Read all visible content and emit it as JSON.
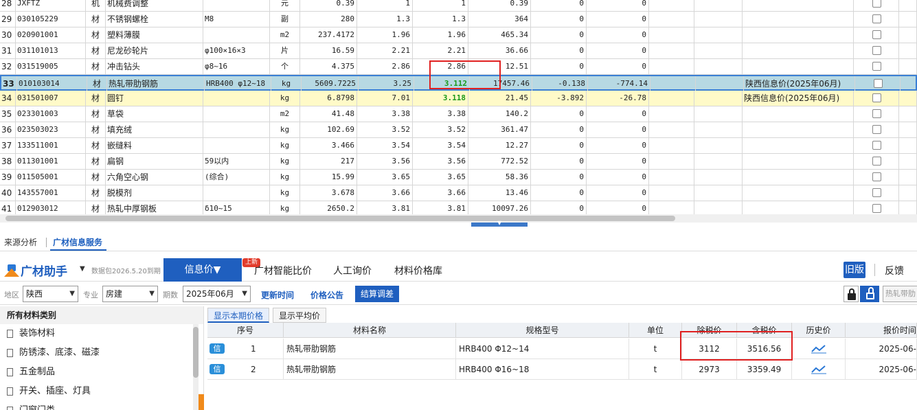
{
  "grid_rows": [
    {
      "no": "28",
      "code": "JXFTZ",
      "cls": "机",
      "name": "机械费调整",
      "spec": "",
      "unit": "元",
      "qty": "0.39",
      "p1": "1",
      "p2": "1",
      "amt": "0.39",
      "d1": "0",
      "d2": "0",
      "note": ""
    },
    {
      "no": "29",
      "code": "030105229",
      "cls": "材",
      "name": "不锈钢螺栓",
      "spec": "M8",
      "unit": "副",
      "qty": "280",
      "p1": "1.3",
      "p2": "1.3",
      "amt": "364",
      "d1": "0",
      "d2": "0",
      "note": ""
    },
    {
      "no": "30",
      "code": "020901001",
      "cls": "材",
      "name": "塑料薄膜",
      "spec": "",
      "unit": "m2",
      "qty": "237.4172",
      "p1": "1.96",
      "p2": "1.96",
      "amt": "465.34",
      "d1": "0",
      "d2": "0",
      "note": ""
    },
    {
      "no": "31",
      "code": "031101013",
      "cls": "材",
      "name": "尼龙砂轮片",
      "spec": "φ100×16×3",
      "unit": "片",
      "qty": "16.59",
      "p1": "2.21",
      "p2": "2.21",
      "amt": "36.66",
      "d1": "0",
      "d2": "0",
      "note": ""
    },
    {
      "no": "32",
      "code": "031519005",
      "cls": "材",
      "name": "冲击钻头",
      "spec": "φ8~16",
      "unit": "个",
      "qty": "4.375",
      "p1": "2.86",
      "p2": "2.86",
      "amt": "12.51",
      "d1": "0",
      "d2": "0",
      "note": ""
    },
    {
      "no": "33",
      "code": "010103014",
      "cls": "材",
      "name": "热轧带肋钢筋",
      "spec": "HRB400 φ12~18",
      "unit": "kg",
      "qty": "5609.7225",
      "p1": "3.25",
      "p2": "3.112",
      "amt": "17457.46",
      "d1": "-0.138",
      "d2": "-774.14",
      "note": "陕西信息价(2025年06月)"
    },
    {
      "no": "34",
      "code": "031501007",
      "cls": "材",
      "name": "圆钉",
      "spec": "",
      "unit": "kg",
      "qty": "6.8798",
      "p1": "7.01",
      "p2": "3.118",
      "amt": "21.45",
      "d1": "-3.892",
      "d2": "-26.78",
      "note": "陕西信息价(2025年06月)"
    },
    {
      "no": "35",
      "code": "023301003",
      "cls": "材",
      "name": "草袋",
      "spec": "",
      "unit": "m2",
      "qty": "41.48",
      "p1": "3.38",
      "p2": "3.38",
      "amt": "140.2",
      "d1": "0",
      "d2": "0",
      "note": ""
    },
    {
      "no": "36",
      "code": "023503023",
      "cls": "材",
      "name": "填充绒",
      "spec": "",
      "unit": "kg",
      "qty": "102.69",
      "p1": "3.52",
      "p2": "3.52",
      "amt": "361.47",
      "d1": "0",
      "d2": "0",
      "note": ""
    },
    {
      "no": "37",
      "code": "133511001",
      "cls": "材",
      "name": "嵌缝料",
      "spec": "",
      "unit": "kg",
      "qty": "3.466",
      "p1": "3.54",
      "p2": "3.54",
      "amt": "12.27",
      "d1": "0",
      "d2": "0",
      "note": ""
    },
    {
      "no": "38",
      "code": "011301001",
      "cls": "材",
      "name": "扁钢",
      "spec": "59以内",
      "unit": "kg",
      "qty": "217",
      "p1": "3.56",
      "p2": "3.56",
      "amt": "772.52",
      "d1": "0",
      "d2": "0",
      "note": ""
    },
    {
      "no": "39",
      "code": "011505001",
      "cls": "材",
      "name": "六角空心钢",
      "spec": "(综合)",
      "unit": "kg",
      "qty": "15.99",
      "p1": "3.65",
      "p2": "3.65",
      "amt": "58.36",
      "d1": "0",
      "d2": "0",
      "note": ""
    },
    {
      "no": "40",
      "code": "143557001",
      "cls": "材",
      "name": "脱模剂",
      "spec": "",
      "unit": "kg",
      "qty": "3.678",
      "p1": "3.66",
      "p2": "3.66",
      "amt": "13.46",
      "d1": "0",
      "d2": "0",
      "note": ""
    },
    {
      "no": "41",
      "code": "012903012",
      "cls": "材",
      "name": "热轧中厚钢板",
      "spec": "δ10~15",
      "unit": "kg",
      "qty": "2650.2",
      "p1": "3.81",
      "p2": "3.81",
      "amt": "10097.26",
      "d1": "0",
      "d2": "0",
      "note": ""
    }
  ],
  "panel_tabs": {
    "source": "来源分析",
    "info": "广材信息服务"
  },
  "toolbar": {
    "logo": "广材助手",
    "expire": "数据包2026.5.20到期",
    "info_price": "信息价▼",
    "badge": "上新",
    "compare": "广材智能比价",
    "inquiry": "人工询价",
    "library": "材料价格库",
    "old_version": "旧版",
    "feedback": "反馈"
  },
  "filters": {
    "region_label": "地区",
    "region": "陕西",
    "major_label": "专业",
    "major": "房建",
    "period_label": "期数",
    "period": "2025年06月",
    "update_time": "更新时间",
    "price_notice": "价格公告",
    "settle": "结算调差",
    "search_placeholder": "热轧带肋"
  },
  "categories": {
    "header": "所有材料类别",
    "items": [
      "装饰材料",
      "防锈漆、底漆、磁漆",
      "五金制品",
      "开关、插座、灯具",
      "门窗门类"
    ]
  },
  "price_tabs": {
    "current": "显示本期价格",
    "average": "显示平均价"
  },
  "price_table": {
    "headers": {
      "seq": "序号",
      "name": "材料名称",
      "spec": "规格型号",
      "unit": "单位",
      "excl": "除税价",
      "incl": "含税价",
      "history": "历史价",
      "date": "报价时间"
    },
    "rows": [
      {
        "tag": "信",
        "seq": "1",
        "name": "热轧带肋钢筋",
        "spec": "HRB400 Φ12~14",
        "unit": "t",
        "excl": "3112",
        "incl": "3516.56",
        "date": "2025-06-"
      },
      {
        "tag": "信",
        "seq": "2",
        "name": "热轧带肋钢筋",
        "spec": "HRB400 Φ16~18",
        "unit": "t",
        "excl": "2973",
        "incl": "3359.49",
        "date": "2025-06-"
      }
    ]
  },
  "colors": {
    "accent": "#1f5fbf",
    "highlight": "#b7d9e3",
    "yellow": "#fffac8",
    "red_box": "#e02020"
  }
}
